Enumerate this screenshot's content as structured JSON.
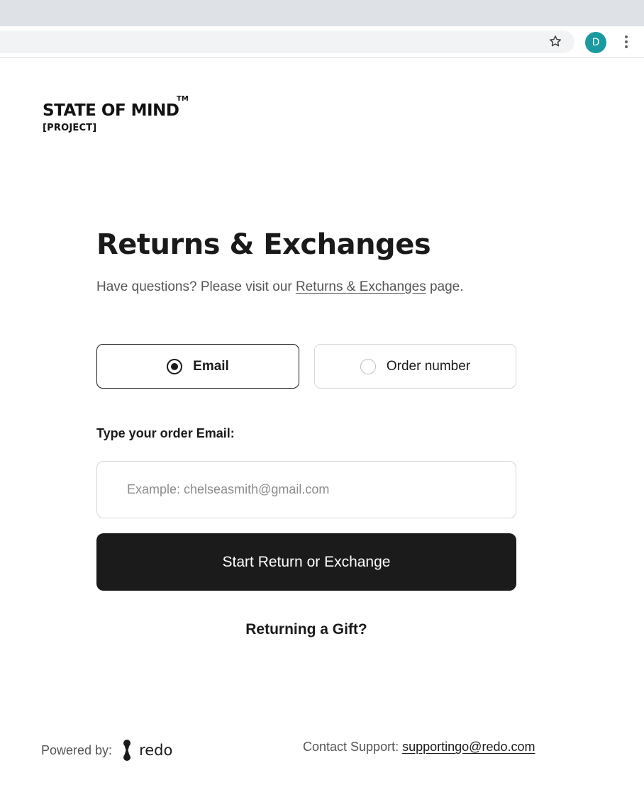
{
  "browser": {
    "profile_initial": "D",
    "bookmark_icon": "star-outline-icon",
    "menu_icon": "vertical-dots-icon",
    "accent": "#1a9aa0"
  },
  "brand": {
    "name": "STATE OF MIND",
    "trademark": "TM",
    "subtitle": "[PROJECT]"
  },
  "main": {
    "title": "Returns & Exchanges",
    "intro_before": "Have questions? Please visit our ",
    "intro_link": "Returns & Exchanges",
    "intro_after": " page.",
    "lookup_options": [
      {
        "label": "Email",
        "selected": true
      },
      {
        "label": "Order number",
        "selected": false
      }
    ],
    "field_label": "Type your order Email:",
    "email_placeholder": "Example: chelseasmith@gmail.com",
    "email_value": "",
    "submit_label": "Start Return or Exchange",
    "gift_link": "Returning a Gift?"
  },
  "footer": {
    "powered_by": "Powered by:",
    "provider": "redo",
    "support_label": "Contact Support:",
    "support_email": "supportingo@redo.com"
  },
  "colors": {
    "button_bg": "#1b1b1b",
    "text": "#1a1a1a",
    "muted_text": "#555555",
    "border": "#d6d6d6"
  }
}
